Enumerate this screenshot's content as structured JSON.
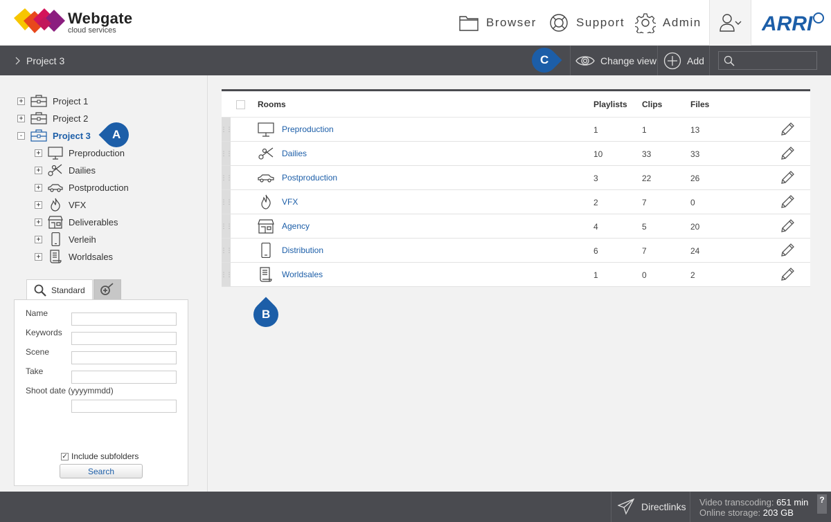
{
  "header": {
    "brand_name": "Webgate",
    "brand_sub": "cloud services",
    "nav": [
      {
        "label": "Browser",
        "icon": "folder-icon"
      },
      {
        "label": "Support",
        "icon": "lifebuoy-icon"
      },
      {
        "label": "Admin",
        "icon": "gear-icon"
      }
    ],
    "partner_logo": "ARRI"
  },
  "toolbar": {
    "breadcrumb": "Project 3",
    "change_view_label": "Change view",
    "add_label": "Add",
    "search_placeholder": ""
  },
  "markers": {
    "a": "A",
    "b": "B",
    "c": "C"
  },
  "tree": {
    "projects": [
      "Project 1",
      "Project 2",
      "Project 3"
    ],
    "rooms": [
      "Preproduction",
      "Dailies",
      "Postproduction",
      "VFX",
      "Deliverables",
      "Verleih",
      "Worldsales"
    ]
  },
  "search": {
    "tab_standard": "Standard",
    "fields": [
      "Name",
      "Keywords",
      "Scene",
      "Take",
      "Shoot date (yyyymmdd)"
    ],
    "include_subfolders": "Include subfolders",
    "button": "Search"
  },
  "table": {
    "headers": {
      "rooms": "Rooms",
      "playlists": "Playlists",
      "clips": "Clips",
      "files": "Files"
    },
    "rows": [
      {
        "name": "Preproduction",
        "playlists": "1",
        "clips": "1",
        "files": "13",
        "icon": "monitor-icon"
      },
      {
        "name": "Dailies",
        "playlists": "10",
        "clips": "33",
        "files": "33",
        "icon": "scissors-icon"
      },
      {
        "name": "Postproduction",
        "playlists": "3",
        "clips": "22",
        "files": "26",
        "icon": "car-icon"
      },
      {
        "name": "VFX",
        "playlists": "2",
        "clips": "7",
        "files": "0",
        "icon": "flame-icon"
      },
      {
        "name": "Agency",
        "playlists": "4",
        "clips": "5",
        "files": "20",
        "icon": "store-icon"
      },
      {
        "name": "Distribution",
        "playlists": "6",
        "clips": "7",
        "files": "24",
        "icon": "phone-icon"
      },
      {
        "name": "Worldsales",
        "playlists": "1",
        "clips": "0",
        "files": "2",
        "icon": "scroll-icon"
      }
    ]
  },
  "footer": {
    "directlinks_label": "Directlinks",
    "video_transcoding_label": "Video transcoding:",
    "video_transcoding_value": "651 min",
    "online_storage_label": "Online storage:",
    "online_storage_value": "203 GB",
    "help_label": "?"
  },
  "colors": {
    "accent": "#1c5ea8",
    "toolbar_bg": "#4a4b50",
    "page_bg": "#f2f2f2"
  }
}
